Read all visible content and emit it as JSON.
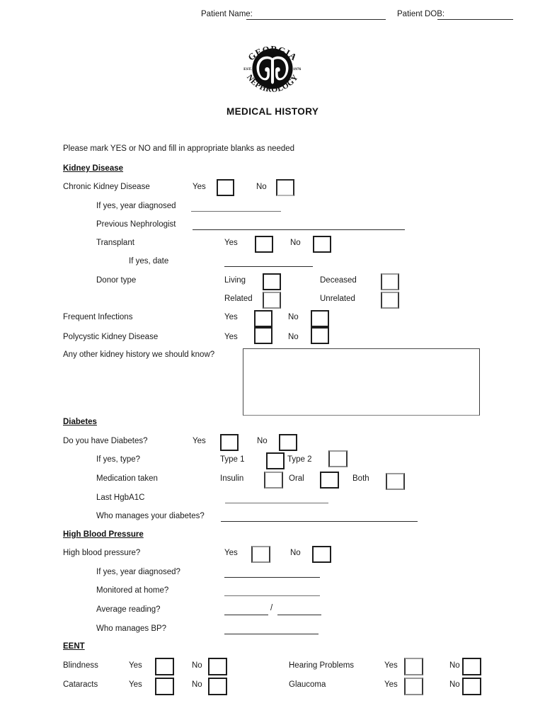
{
  "header": {
    "patient_name_label": "Patient Name:",
    "patient_name_value": "",
    "patient_dob_label": "Patient DOB:",
    "patient_dob_value": ""
  },
  "logo": {
    "top_arc_text": "GEORGIA",
    "bottom_arc_text": "NEPHROLOGY",
    "est_label": "EST.",
    "est_year": "1976",
    "alt": "georgia-nephrology-kidney-logo"
  },
  "document": {
    "title": "MEDICAL HISTORY",
    "instructions": "Please mark YES or NO and fill in appropriate blanks as needed"
  },
  "common": {
    "yes": "Yes",
    "no": "No"
  },
  "sections": {
    "kidney": {
      "heading": "Kidney Disease",
      "chronic_kidney_disease": "Chronic Kidney Disease",
      "if_yes_year_diagnosed": "If yes, year diagnosed",
      "previous_nephrologist": "Previous Nephrologist",
      "transplant": "Transplant",
      "if_yes_date": "If yes, date",
      "donor_type": "Donor type",
      "living": "Living",
      "deceased": "Deceased",
      "related": "Related",
      "unrelated": "Unrelated",
      "frequent_infections": "Frequent Infections",
      "polycystic_kidney_disease": "Polycystic Kidney Disease",
      "other_history_question": "Any other kidney history we should know?",
      "other_history_value": ""
    },
    "diabetes": {
      "heading": "Diabetes",
      "question": "Do you have Diabetes?",
      "if_yes_type": "If yes, type?",
      "type1": "Type 1",
      "type2": "Type 2",
      "medication_taken": "Medication taken",
      "insulin": "Insulin",
      "oral": "Oral",
      "both": "Both",
      "last_hgba1c": "Last HgbA1C",
      "last_hgba1c_value": "",
      "who_manages": "Who manages your diabetes?",
      "who_manages_value": ""
    },
    "hbp": {
      "heading": "High Blood Pressure",
      "question": "High blood pressure?",
      "if_yes_year_diagnosed": "If yes, year diagnosed?",
      "if_yes_year_value": "",
      "monitored_at_home": "Monitored at home?",
      "monitored_value": "",
      "average_reading": "Average reading?",
      "average_systolic_value": "",
      "average_slash": "/",
      "average_diastolic_value": "",
      "who_manages_bp": "Who manages BP?",
      "who_manages_bp_value": ""
    },
    "eent": {
      "heading": "EENT",
      "rows": [
        {
          "left_label": "Blindness",
          "right_label": "Hearing Problems"
        },
        {
          "left_label": "Cataracts",
          "right_label": "Glaucoma"
        }
      ]
    }
  },
  "colors": {
    "ink": "#1a1a1a",
    "rule": "#3b3b3b",
    "box_border": "#1d1d1d",
    "page_background": "#ffffff"
  }
}
